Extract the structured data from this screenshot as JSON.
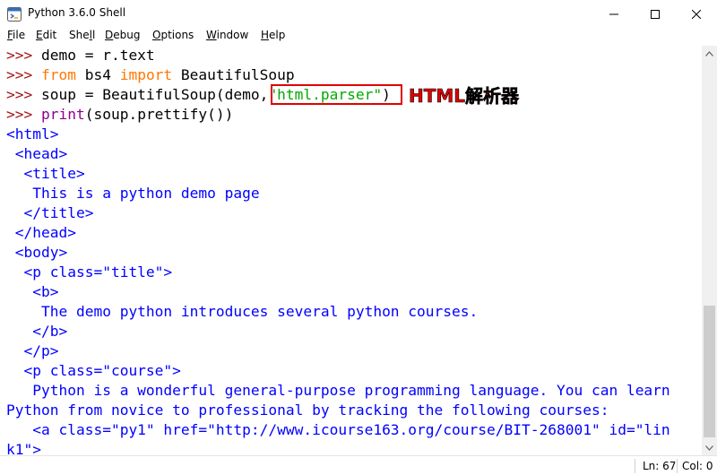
{
  "window": {
    "title": "Python 3.6.0 Shell",
    "icon": "python-idle-icon"
  },
  "menu": [
    {
      "pre": "",
      "key": "F",
      "post": "ile"
    },
    {
      "pre": "",
      "key": "E",
      "post": "dit"
    },
    {
      "pre": "She",
      "key": "l",
      "post": "l"
    },
    {
      "pre": "",
      "key": "D",
      "post": "ebug"
    },
    {
      "pre": "",
      "key": "O",
      "post": "ptions"
    },
    {
      "pre": "",
      "key": "W",
      "post": "indow"
    },
    {
      "pre": "",
      "key": "H",
      "post": "elp"
    }
  ],
  "shell": {
    "prompt": ">>> ",
    "commands": {
      "l1": "demo = r.text",
      "l2_kw1": "from",
      "l2_mid": " bs4 ",
      "l2_kw2": "import",
      "l2_end": " BeautifulSoup",
      "l3_pre": "soup = BeautifulSoup(demo,",
      "l3_str": "\"html.parser\"",
      "l3_end": ")",
      "l4_fn": "print",
      "l4_end": "(soup.prettify())"
    },
    "output": [
      "<html>",
      " <head>",
      "  <title>",
      "   This is a python demo page",
      "  </title>",
      " </head>",
      " <body>",
      "  <p class=\"title\">",
      "   <b>",
      "    The demo python introduces several python courses.",
      "   </b>",
      "  </p>",
      "  <p class=\"course\">",
      "   Python is a wonderful general-purpose programming language. You can learn",
      "Python from novice to professional by tracking the following courses:",
      "   <a class=\"py1\" href=\"http://www.icourse163.org/course/BIT-268001\" id=\"lin",
      "k1\">"
    ]
  },
  "annotation": {
    "label": "HTML解析器",
    "color": "#e00000"
  },
  "colors": {
    "prompt": "#a31515",
    "keyword": "#ff7700",
    "builtin": "#900090",
    "string": "#00aa00",
    "output": "#0000ff"
  },
  "status": {
    "line": "Ln: 67",
    "col": "Col: 0"
  }
}
